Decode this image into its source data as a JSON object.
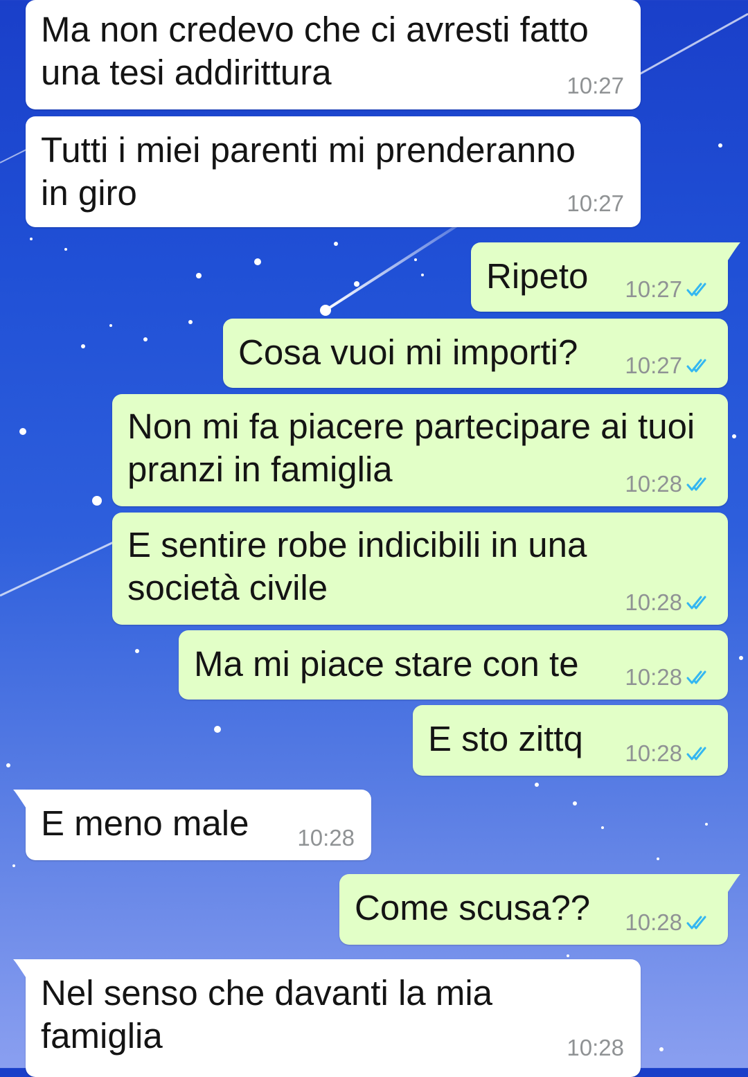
{
  "accent": {
    "incoming_bubble": "#ffffff",
    "outgoing_bubble": "#e2ffc7",
    "read_ticks": "#34b7f1",
    "timestamp": "#8f9294"
  },
  "messages": [
    {
      "direction": "incoming",
      "text": "Ma non credevo che ci avresti fatto\nuna tesi addirittura",
      "time": "10:27"
    },
    {
      "direction": "incoming",
      "text": "Tutti i miei parenti mi prenderanno\nin giro",
      "time": "10:27"
    },
    {
      "direction": "outgoing",
      "text": "Ripeto",
      "time": "10:27",
      "status_icon": "double-check-read-icon"
    },
    {
      "direction": "outgoing",
      "text": "Cosa vuoi mi importi?",
      "time": "10:27",
      "status_icon": "double-check-read-icon"
    },
    {
      "direction": "outgoing",
      "text": "Non mi fa piacere partecipare ai tuoi\npranzi in famiglia",
      "time": "10:28",
      "status_icon": "double-check-read-icon"
    },
    {
      "direction": "outgoing",
      "text": "E sentire robe indicibili in una\nsocietà civile",
      "time": "10:28",
      "status_icon": "double-check-read-icon"
    },
    {
      "direction": "outgoing",
      "text": "Ma mi piace stare con te",
      "time": "10:28",
      "status_icon": "double-check-read-icon"
    },
    {
      "direction": "outgoing",
      "text": "E sto zittq",
      "time": "10:28",
      "status_icon": "double-check-read-icon"
    },
    {
      "direction": "incoming",
      "text": "E meno male",
      "time": "10:28"
    },
    {
      "direction": "outgoing",
      "text": "Come scusa??",
      "time": "10:28",
      "status_icon": "double-check-read-icon"
    },
    {
      "direction": "incoming",
      "text": "Nel senso che davanti la mia\nfamiglia",
      "time": "10:28"
    }
  ]
}
